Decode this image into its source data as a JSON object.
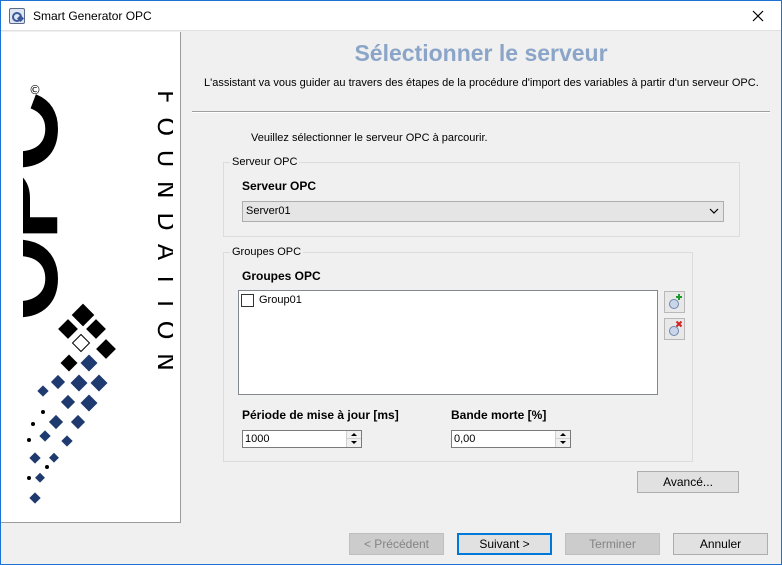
{
  "window": {
    "title": "Smart Generator OPC"
  },
  "header": {
    "title": "Sélectionner le serveur",
    "description": "L'assistant va vous guider au travers des étapes de la procédure d'import des variables à partir d'un serveur OPC."
  },
  "logo": {
    "brand": "OPC",
    "subtitle": "FOUNDATION",
    "mark": "©"
  },
  "instruction": "Veuillez sélectionner le serveur OPC à parcourir.",
  "server_group": {
    "legend": "Serveur OPC",
    "label": "Serveur OPC",
    "selected": "Server01"
  },
  "groups_group": {
    "legend": "Groupes OPC",
    "label": "Groupes OPC",
    "items": [
      {
        "label": "Group01",
        "checked": false
      }
    ],
    "update_period_label": "Période de mise à jour [ms]",
    "update_period_value": "1000",
    "deadband_label": "Bande morte [%]",
    "deadband_value": "0,00"
  },
  "buttons": {
    "advanced": "Avancé...",
    "previous": "< Précédent",
    "next": "Suivant >",
    "finish": "Terminer",
    "cancel": "Annuler"
  },
  "colors": {
    "title_accent": "#8ba5c8",
    "window_border": "#1c73d3",
    "focus": "#0078d7"
  }
}
